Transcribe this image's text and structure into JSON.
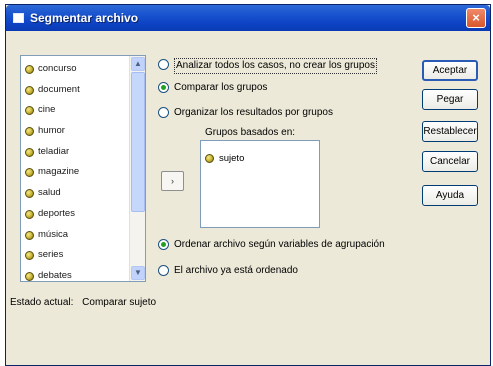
{
  "window": {
    "title": "Segmentar archivo",
    "close_label": "×"
  },
  "variables": {
    "items": [
      "concurso",
      "document",
      "cine",
      "humor",
      "teladiar",
      "magazine",
      "salud",
      "deportes",
      "música",
      "series",
      "debates"
    ],
    "scroll_up": "▲",
    "scroll_down": "▼"
  },
  "options": {
    "analyze_all": "Analizar todos los casos, no crear los grupos",
    "compare_groups": "Comparar los grupos",
    "organize_output": "Organizar los resultados por grupos",
    "selected": "compare_groups"
  },
  "groups": {
    "label": "Grupos basados en:",
    "items": [
      "sujeto"
    ],
    "move_button": "›"
  },
  "sort_options": {
    "sort_file": "Ordenar archivo según variables de agrupación",
    "already_sorted": "El archivo ya está ordenado",
    "selected": "sort_file"
  },
  "buttons": {
    "accept": "Aceptar",
    "paste": "Pegar",
    "reset": "Restablecer",
    "cancel": "Cancelar",
    "help": "Ayuda"
  },
  "status": {
    "label": "Estado actual:",
    "value": "Comparar sujeto"
  },
  "colors": {
    "titlebar": "#0d43c5",
    "dialog_bg": "#ece9d8",
    "radio_dot": "#21a121",
    "close_button": "#d8562c"
  }
}
